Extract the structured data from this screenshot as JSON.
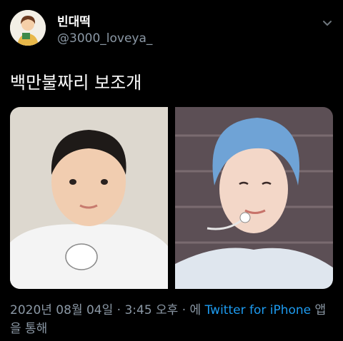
{
  "user": {
    "display_name": "빈대떡",
    "handle": "@3000_loveya_"
  },
  "tweet": {
    "text": "백만불짜리 보조개"
  },
  "meta": {
    "timestamp": "2020년 08월 04일 · 3:45 오후 · 에",
    "source_app": "Twitter for iPhone",
    "source_suffix": "앱을 통해"
  },
  "icons": {
    "more": "chevron-down-icon",
    "avatar": "avatar-image"
  },
  "colors": {
    "background": "#000000",
    "text": "#ffffff",
    "secondary": "#8b98a5",
    "link": "#1d9bf0"
  }
}
